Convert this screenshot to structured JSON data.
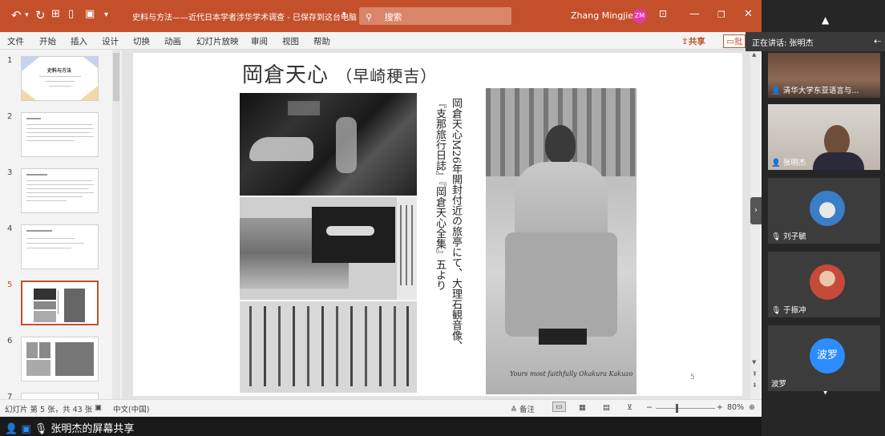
{
  "titlebar": {
    "doc_title": "史料与方法——近代日本学者涉华学术调查 - 已保存到这台电脑",
    "search_placeholder": "搜索",
    "user_name": "Zhang Mingjie",
    "user_initials": "ZM"
  },
  "ribbon": {
    "tabs": [
      "文件",
      "开始",
      "插入",
      "设计",
      "切换",
      "动画",
      "幻灯片放映",
      "审阅",
      "视图",
      "帮助"
    ],
    "share_label": "共享",
    "comment_label": "批"
  },
  "thumbnails": {
    "numbers": [
      "1",
      "2",
      "3",
      "4",
      "5",
      "6",
      "7"
    ],
    "slide1_title": "史料与方法",
    "selected": "5"
  },
  "slide": {
    "title": "岡倉天心",
    "subtitle": "（早崎稉吉）",
    "caption": "岡倉天心M26年開封付近の旅亭にて、大理石観音像、『支那旅行日誌』『岡倉天心全集』五より",
    "page_number": "5",
    "signature": "Yours most faithfully Okakura Kakuzo"
  },
  "statusbar": {
    "slide_info": "幻灯片 第 5 张，共 43 张",
    "language": "中文(中国)",
    "notes_label": "备注",
    "zoom": "80%"
  },
  "sharing": {
    "label": "张明杰的屏幕共享"
  },
  "zoom_panel": {
    "speaking_label": "正在讲话: 张明杰",
    "participants": [
      {
        "name": "清华大学东亚语言与..."
      },
      {
        "name": "张明杰"
      },
      {
        "name": "刘子毓"
      },
      {
        "name": "于振冲"
      },
      {
        "name": "波罗",
        "avatar_text": "波罗"
      }
    ]
  },
  "colors": {
    "accent": "#c3502b",
    "zoom_blue": "#2d8cff"
  }
}
